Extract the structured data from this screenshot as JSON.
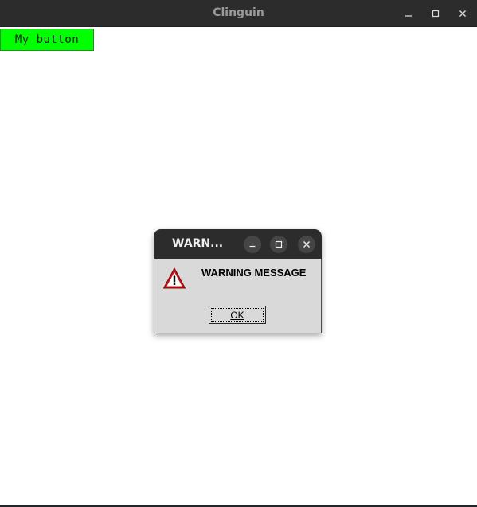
{
  "window": {
    "title": "Clinguin",
    "controls": [
      "minimize-icon",
      "maximize-icon",
      "close-icon"
    ]
  },
  "main": {
    "button_label": "My button",
    "button_color": "#00ff00"
  },
  "dialog": {
    "title": "WARN...",
    "message": "WARNING MESSAGE",
    "icon": "warning-icon",
    "ok_label": "OK",
    "controls": [
      "minimize-icon",
      "maximize-icon",
      "close-icon"
    ]
  }
}
